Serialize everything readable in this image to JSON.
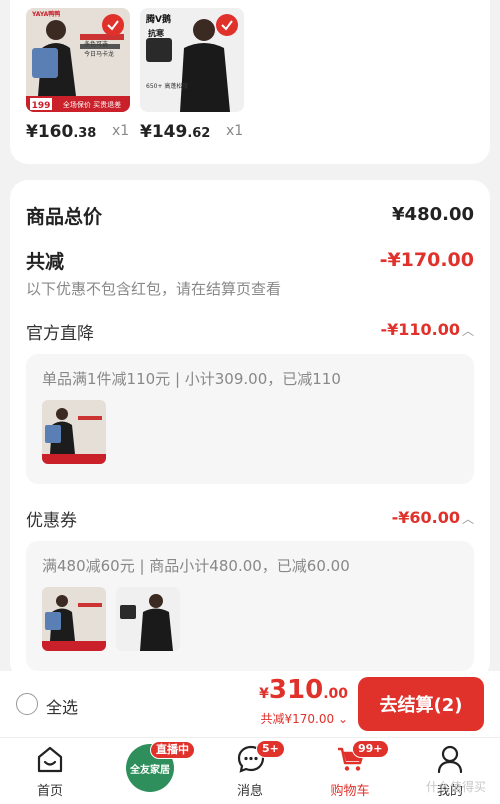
{
  "top_products": [
    {
      "price_int": "¥160",
      "price_dec": ".38",
      "qty": "x1",
      "thumb_brand": "YAYA鸭鸭",
      "thumb_text1": "多色可选",
      "thumb_text2": "今日马卡龙",
      "thumb_price": "199",
      "thumb_banner": "全场保价 买贵退差"
    },
    {
      "price_int": "¥149",
      "price_dec": ".62",
      "qty": "x1",
      "thumb_brand": "腾V鹅",
      "thumb_text1": "抗寒",
      "thumb_text2": "650+ 高蓬松度"
    }
  ],
  "summary": {
    "total_label": "商品总价",
    "total_value": "¥480.00",
    "discount_label": "共减",
    "discount_value": "-¥170.00",
    "note": "以下优惠不包含红包，请在结算页查看",
    "official": {
      "label": "官方直降",
      "value": "-¥110.00",
      "desc": "单品满1件减110元 | 小计309.00，已减110"
    },
    "coupon": {
      "label": "优惠券",
      "value": "-¥60.00",
      "desc": "满480减60元 | 商品小计480.00，已减60.00"
    }
  },
  "action_bar": {
    "select_all": "全选",
    "yen": "¥",
    "total_int": "310",
    "total_dec": ".00",
    "total_discount": "共减¥170.00 ⌄",
    "checkout": "去结算(2)"
  },
  "tabbar": {
    "home": "首页",
    "live_circle": "全友家居",
    "live_badge": "直播中",
    "messages": "消息",
    "messages_badge": "5+",
    "cart": "购物车",
    "cart_badge": "99+",
    "mine": "我的",
    "watermark": "什么值得买"
  },
  "colors": {
    "accent": "#e0312b",
    "background": "#f2f2f2"
  }
}
